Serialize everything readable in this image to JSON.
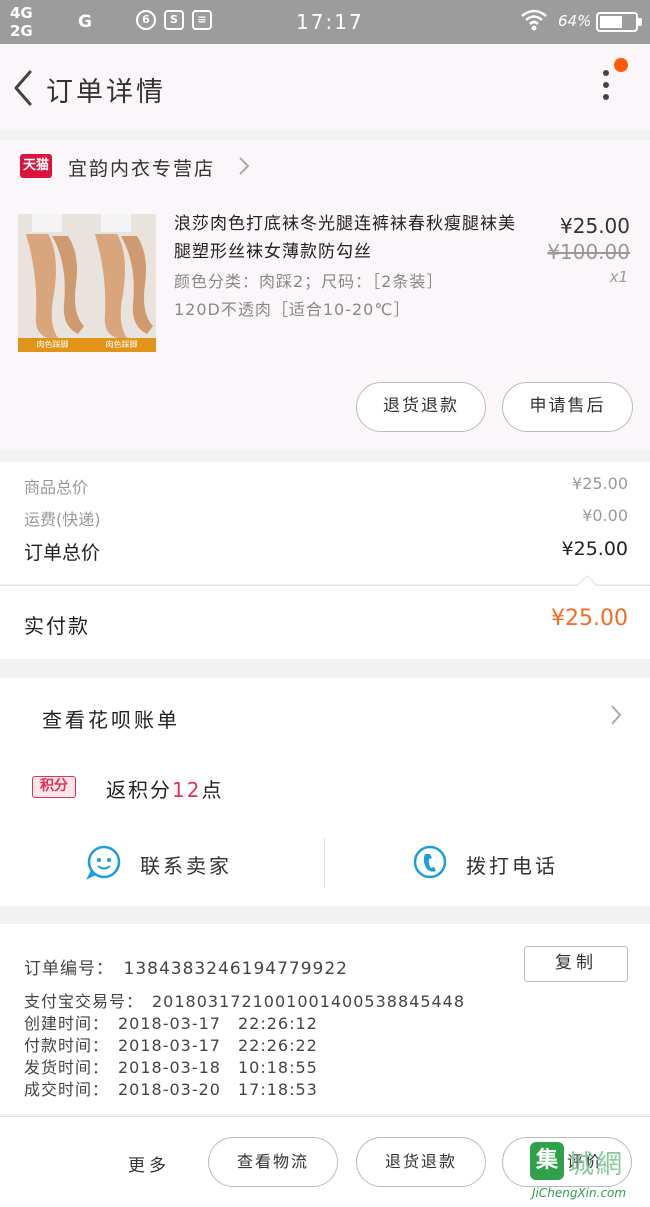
{
  "status_bar": {
    "network_top": "4G",
    "network_bottom": "2G",
    "network_g": "G",
    "time": "17:17",
    "battery_text": "64%",
    "battery_level": 0.64
  },
  "header": {
    "title": "订单详情"
  },
  "store": {
    "badge": "天猫",
    "name": "宜韵内衣专营店"
  },
  "product": {
    "title": "浪莎肉色打底袜冬光腿连裤袜春秋瘦腿袜美腿塑形丝袜女薄款防勾丝",
    "sku_line1": "颜色分类：肉踩2；尺码：［2条装］",
    "sku_line2": "120D不透肉［适合10-20℃］",
    "thumb_caption_left": "肉色踩脚",
    "thumb_caption_right": "肉色踩脚",
    "price": "¥25.00",
    "original_price": "¥100.00",
    "quantity": "x1",
    "buttons": {
      "refund": "退货退款",
      "after_sale": "申请售后"
    }
  },
  "summary": {
    "goods_total_label": "商品总价",
    "goods_total": "¥25.00",
    "shipping_label": "运费(快递)",
    "shipping": "¥0.00",
    "order_total_label": "订单总价",
    "order_total": "¥25.00",
    "paid_label": "实付款",
    "paid": "¥25.00"
  },
  "huabei": {
    "label": "查看花呗账单"
  },
  "points": {
    "badge": "积分",
    "text_before": "返积分",
    "number": "12",
    "text_after": "点"
  },
  "contact": {
    "seller": "联系卖家",
    "phone": "拨打电话"
  },
  "order_info": {
    "order_no": "订单编号：　1384383246194779922",
    "copy": "复制",
    "alipay_no": "支付宝交易号：　2018031721001001400538845448",
    "created": "创建时间：　2018-03-17　22:26:12",
    "paid_time": "付款时间：　2018-03-17　22:26:22",
    "shipped": "发货时间：　2018-03-18　10:18:55",
    "completed": "成交时间：　2018-03-20　17:18:53"
  },
  "bottom_bar": {
    "more": "更多",
    "logistics": "查看物流",
    "refund": "退货退款",
    "review": "追加评价"
  },
  "watermark": {
    "box_char": "集",
    "chars": "城網",
    "url": "JiChengXin.com"
  },
  "colors": {
    "accent_orange": "#f46b24",
    "points_red": "#e03353",
    "tmall_red": "#d9143c",
    "contact_blue": "#1a9ee0"
  }
}
